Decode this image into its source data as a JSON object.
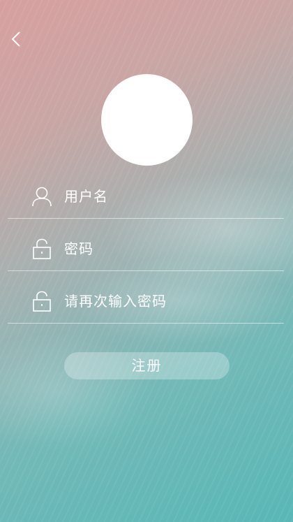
{
  "nav": {
    "back_icon": "chevron-left-icon"
  },
  "avatar": {
    "color": "#ffffff"
  },
  "form": {
    "username_placeholder": "用户名",
    "password_placeholder": "密码",
    "confirm_placeholder": "请再次输入密码",
    "username_icon": "user-icon",
    "password_icon": "lock-icon"
  },
  "register": {
    "label": "注册"
  }
}
